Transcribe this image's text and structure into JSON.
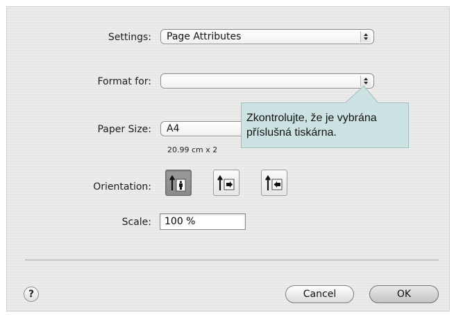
{
  "dialog": {
    "settings": {
      "label": "Settings:",
      "value": "Page Attributes"
    },
    "format_for": {
      "label": "Format for:",
      "value": ""
    },
    "paper_size": {
      "label": "Paper Size:",
      "value": "A4",
      "dimensions": "20.99 cm x 2"
    },
    "orientation": {
      "label": "Orientation:",
      "options": [
        {
          "name": "portrait",
          "selected": true
        },
        {
          "name": "landscape-left",
          "selected": false
        },
        {
          "name": "landscape-right",
          "selected": false
        }
      ]
    },
    "scale": {
      "label": "Scale:",
      "value": "100 %"
    },
    "help_label": "?",
    "cancel_label": "Cancel",
    "ok_label": "OK"
  },
  "callout": {
    "line1": "Zkontrolujte, že je vybrána",
    "line2": "příslušná tiskárna."
  },
  "colors": {
    "callout_bg": "#cde2e2",
    "selected_orientation": "#8f8f8f"
  },
  "icons": [
    "popup-arrows-icon",
    "portrait-icon",
    "landscape-left-icon",
    "landscape-right-icon",
    "help-icon"
  ]
}
